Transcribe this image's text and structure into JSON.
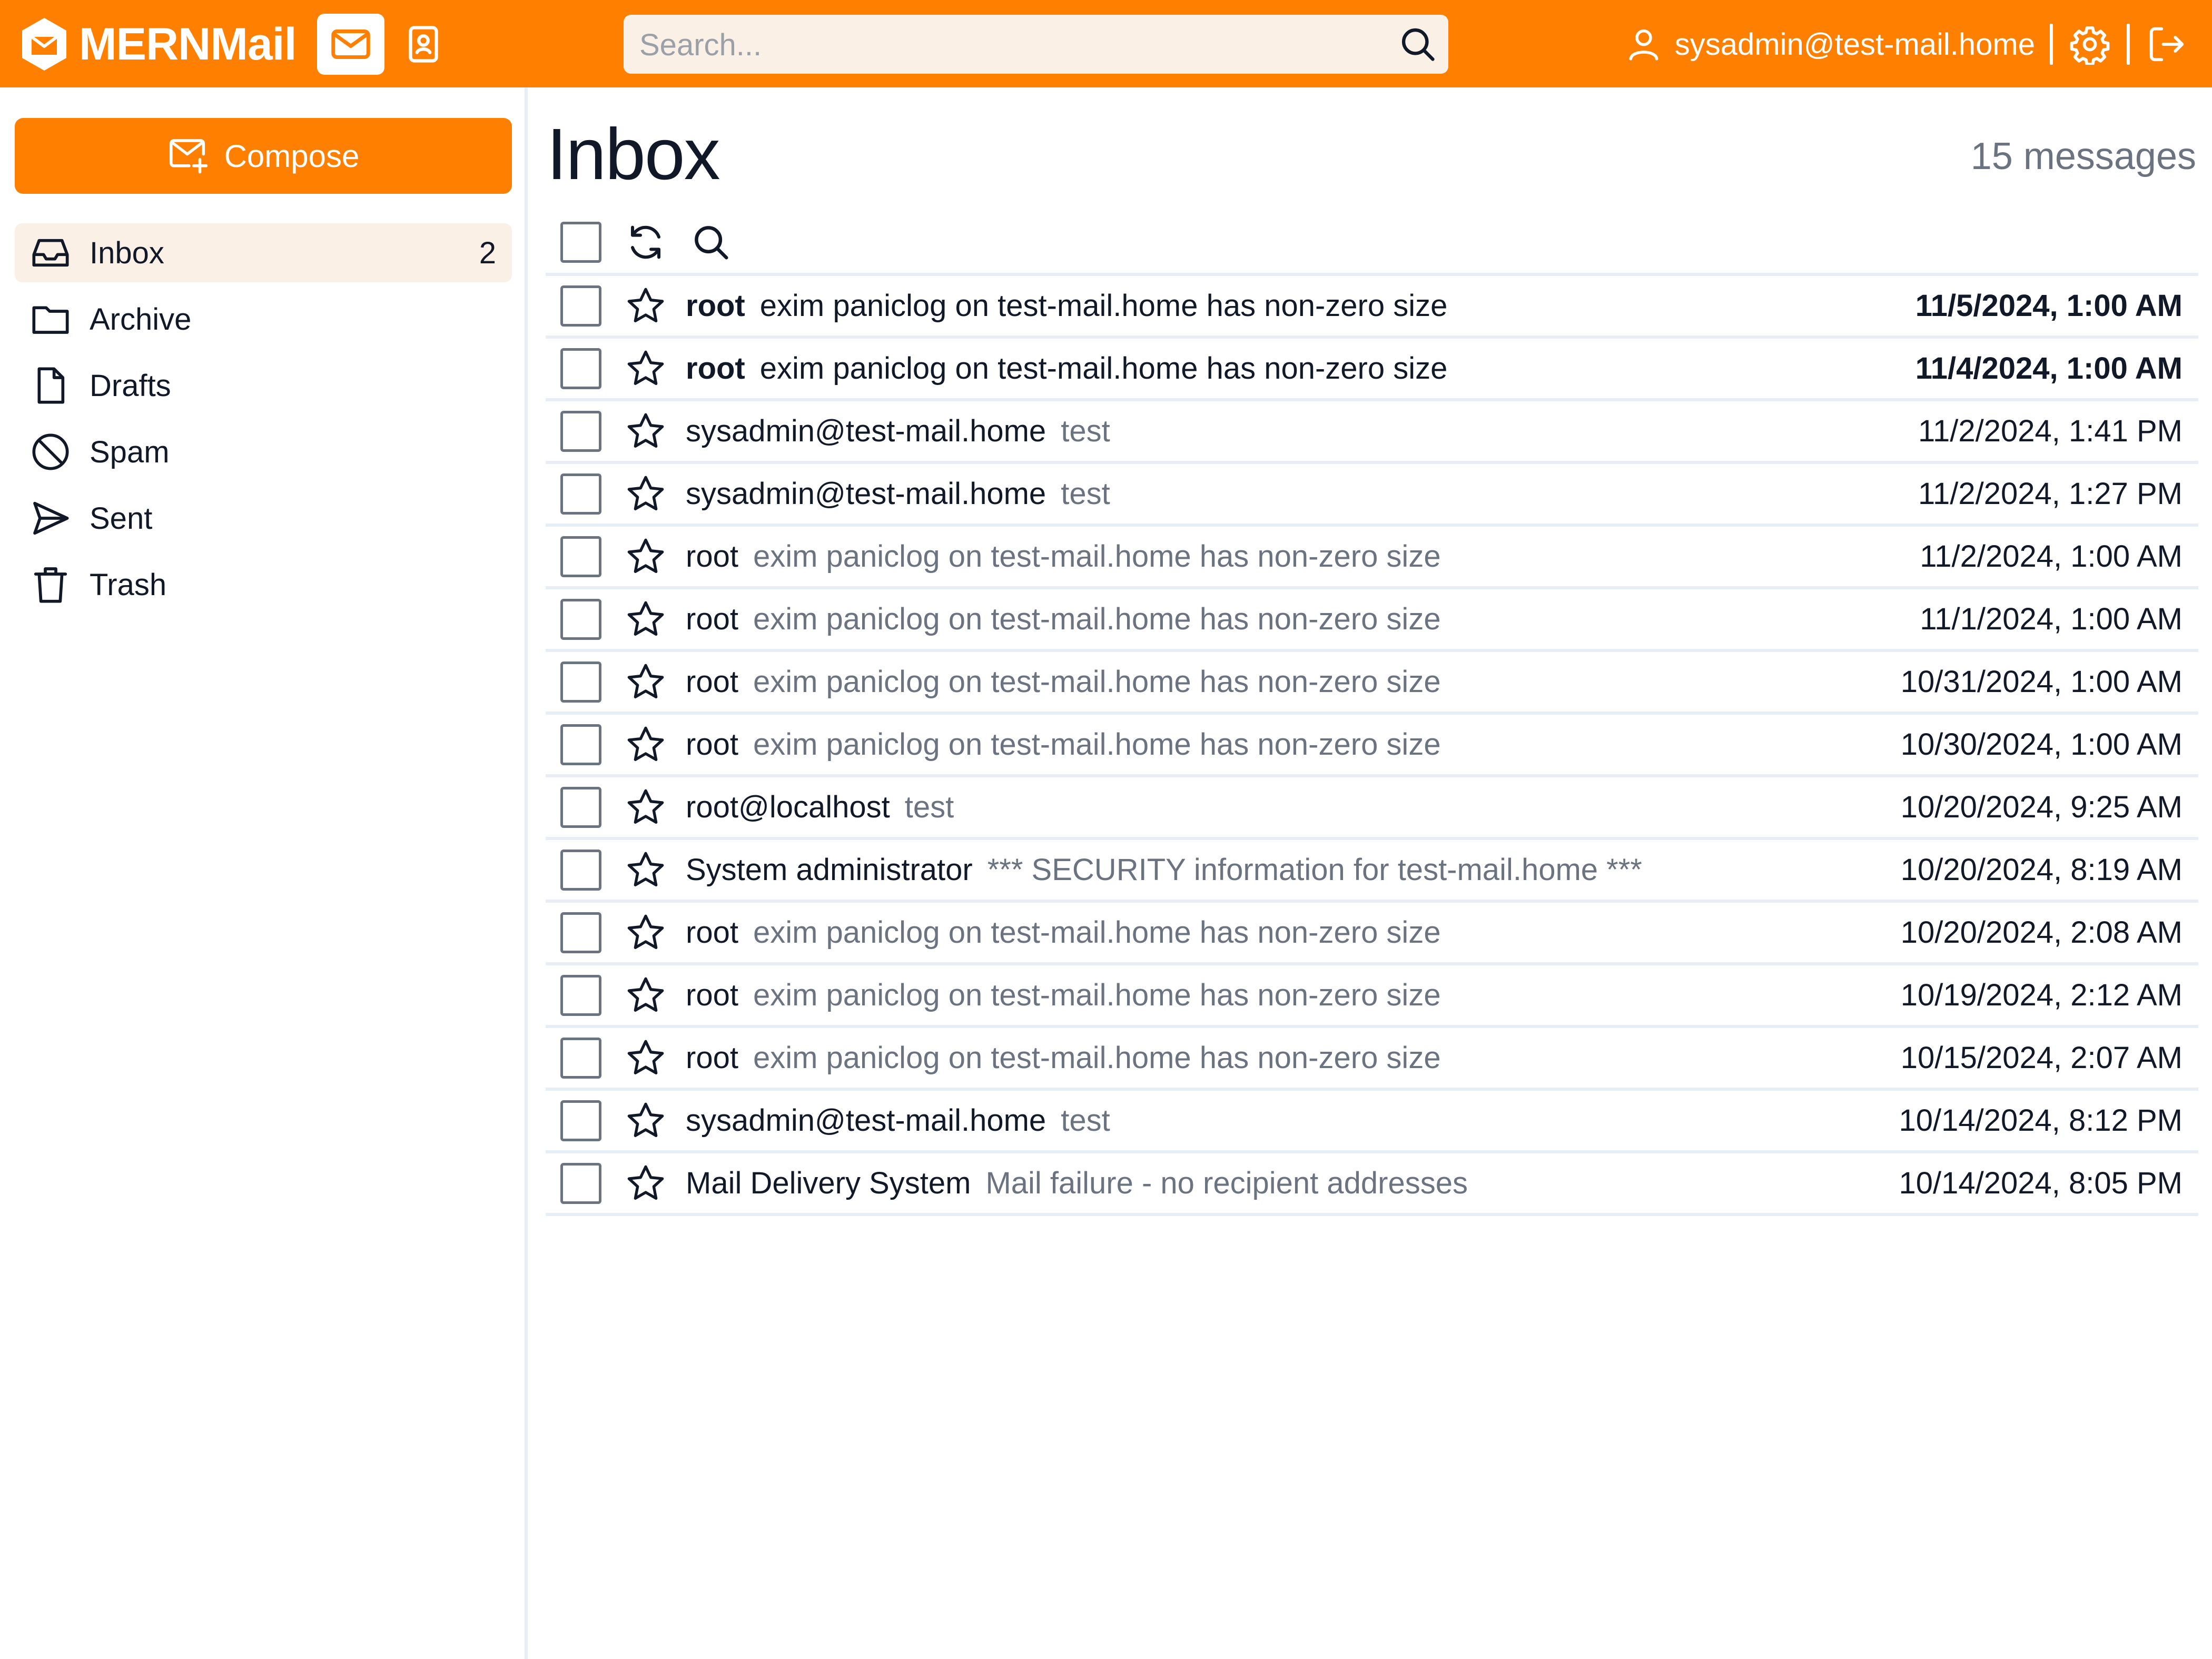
{
  "header": {
    "app_name": "MERNMail",
    "search_placeholder": "Search...",
    "user_email": "sysadmin@test-mail.home",
    "accent_color": "#FF8000"
  },
  "sidebar": {
    "compose_label": "Compose",
    "folders": [
      {
        "label": "Inbox",
        "icon": "inbox-icon",
        "count": "2",
        "active": true
      },
      {
        "label": "Archive",
        "icon": "folder-icon",
        "count": "",
        "active": false
      },
      {
        "label": "Drafts",
        "icon": "document-icon",
        "count": "",
        "active": false
      },
      {
        "label": "Spam",
        "icon": "block-icon",
        "count": "",
        "active": false
      },
      {
        "label": "Sent",
        "icon": "send-icon",
        "count": "",
        "active": false
      },
      {
        "label": "Trash",
        "icon": "trash-icon",
        "count": "",
        "active": false
      }
    ]
  },
  "main": {
    "title": "Inbox",
    "message_count": "15 messages",
    "messages": [
      {
        "sender": "root",
        "subject": "exim paniclog on test-mail.home has non-zero size",
        "date": "11/5/2024, 1:00 AM",
        "unread": true
      },
      {
        "sender": "root",
        "subject": "exim paniclog on test-mail.home has non-zero size",
        "date": "11/4/2024, 1:00 AM",
        "unread": true
      },
      {
        "sender": "sysadmin@test-mail.home",
        "subject": "test",
        "date": "11/2/2024, 1:41 PM",
        "unread": false
      },
      {
        "sender": "sysadmin@test-mail.home",
        "subject": "test",
        "date": "11/2/2024, 1:27 PM",
        "unread": false
      },
      {
        "sender": "root",
        "subject": "exim paniclog on test-mail.home has non-zero size",
        "date": "11/2/2024, 1:00 AM",
        "unread": false
      },
      {
        "sender": "root",
        "subject": "exim paniclog on test-mail.home has non-zero size",
        "date": "11/1/2024, 1:00 AM",
        "unread": false
      },
      {
        "sender": "root",
        "subject": "exim paniclog on test-mail.home has non-zero size",
        "date": "10/31/2024, 1:00 AM",
        "unread": false
      },
      {
        "sender": "root",
        "subject": "exim paniclog on test-mail.home has non-zero size",
        "date": "10/30/2024, 1:00 AM",
        "unread": false
      },
      {
        "sender": "root@localhost",
        "subject": "test",
        "date": "10/20/2024, 9:25 AM",
        "unread": false
      },
      {
        "sender": "System administrator",
        "subject": "*** SECURITY information for test-mail.home ***",
        "date": "10/20/2024, 8:19 AM",
        "unread": false
      },
      {
        "sender": "root",
        "subject": "exim paniclog on test-mail.home has non-zero size",
        "date": "10/20/2024, 2:08 AM",
        "unread": false
      },
      {
        "sender": "root",
        "subject": "exim paniclog on test-mail.home has non-zero size",
        "date": "10/19/2024, 2:12 AM",
        "unread": false
      },
      {
        "sender": "root",
        "subject": "exim paniclog on test-mail.home has non-zero size",
        "date": "10/15/2024, 2:07 AM",
        "unread": false
      },
      {
        "sender": "sysadmin@test-mail.home",
        "subject": "test",
        "date": "10/14/2024, 8:12 PM",
        "unread": false
      },
      {
        "sender": "Mail Delivery System",
        "subject": "Mail failure - no recipient addresses",
        "date": "10/14/2024, 8:05 PM",
        "unread": false
      }
    ]
  }
}
